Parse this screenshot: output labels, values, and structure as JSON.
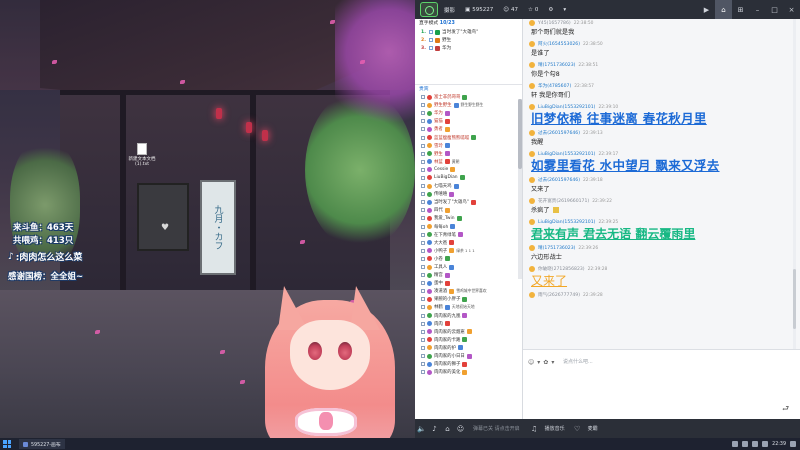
{
  "scene": {
    "desktop_file": {
      "name": "新建文本文档",
      "ext": "(1).txt"
    },
    "sign_text": "九月・カフ",
    "stats": {
      "line1": "来斗鱼：463天",
      "line2": "共喂鸡：413只"
    },
    "tiktok_text": ":肉肉怎么这么菜",
    "thanks_text": "感谢国榜：全全姐~"
  },
  "topbar": {
    "app_label": "摄影",
    "room_id": "595227",
    "viewers": "47",
    "likes": "0"
  },
  "left_col": {
    "header_label": "直手模式",
    "header_date": "10/23",
    "ranks": [
      {
        "num": "1.",
        "name": "当时发了\"大雄鸟\""
      },
      {
        "num": "2.",
        "name": "野生"
      },
      {
        "num": "3.",
        "name": "华为"
      }
    ],
    "members_title": "贵宾",
    "members": [
      {
        "name": "富士非鸽哥哥",
        "tag": "",
        "red": true
      },
      {
        "name": "野生野生",
        "tag": "野生野生野生",
        "red": true
      },
      {
        "name": "华为",
        "tag": "",
        "red": true
      },
      {
        "name": "猫猫",
        "tag": "",
        "red": true
      },
      {
        "name": "勇者",
        "tag": "",
        "red": true
      },
      {
        "name": "蓝蓝瘦瘦熊熊呱呱",
        "tag": "",
        "red": true
      },
      {
        "name": "雪玲",
        "tag": "",
        "red": true
      },
      {
        "name": "野生",
        "tag": "",
        "red": true
      },
      {
        "name": "林蓝",
        "tag": "黄朝",
        "red": true
      },
      {
        "name": "Cessie",
        "tag": "",
        "red": false
      },
      {
        "name": "LiuBigDian",
        "tag": "",
        "red": false
      },
      {
        "name": "七喵天鸡",
        "tag": "",
        "red": false
      },
      {
        "name": "传嘻嘻",
        "tag": "",
        "red": false
      },
      {
        "name": "当时发了\"大雄鸟\"",
        "tag": "",
        "red": false
      },
      {
        "name": "四代",
        "tag": "",
        "red": false
      },
      {
        "name": "我爱_Twin",
        "tag": "",
        "red": false
      },
      {
        "name": "每每oh",
        "tag": "",
        "red": false
      },
      {
        "name": "在下青绿笔",
        "tag": "",
        "red": false
      },
      {
        "name": "大大爸",
        "tag": "",
        "red": false
      },
      {
        "name": "小鸭子",
        "tag": "绿茶 1 1 1",
        "red": false
      },
      {
        "name": "小卷",
        "tag": "",
        "red": false
      },
      {
        "name": "工具人",
        "tag": "",
        "red": false
      },
      {
        "name": "精宫",
        "tag": "",
        "red": false
      },
      {
        "name": "蛋中",
        "tag": "",
        "red": false
      },
      {
        "name": "凑道酒",
        "tag": "雪鸡城中世界喜欢",
        "red": false
      },
      {
        "name": "果腕的小胖子",
        "tag": "",
        "red": false
      },
      {
        "name": "林鹤",
        "tag": "天地初始天地",
        "red": false
      },
      {
        "name": "肉肉家的九凰",
        "tag": "",
        "red": false
      },
      {
        "name": "肉肉",
        "tag": "",
        "red": false
      },
      {
        "name": "肉肉家的云烟崽",
        "tag": "",
        "red": false
      },
      {
        "name": "肉肉家的卡路",
        "tag": "",
        "red": false
      },
      {
        "name": "肉肉家的护",
        "tag": "",
        "red": false
      },
      {
        "name": "肉肉家的小日日",
        "tag": "",
        "red": false
      },
      {
        "name": "肉肉家的狮子",
        "tag": "",
        "red": false
      },
      {
        "name": "肉肉家的美化",
        "tag": "",
        "red": false
      }
    ]
  },
  "chat": [
    {
      "name": "Y45(1657786)",
      "time": "22:38:50",
      "text": "那个哥们就是我",
      "style": "normal",
      "gray": true
    },
    {
      "name": "阿火(1654553026)",
      "time": "22:38:50",
      "text": "是谁了",
      "style": "normal",
      "gray": false
    },
    {
      "name": "晴(1751736023)",
      "time": "22:38:51",
      "text": "你是个勾8",
      "style": "normal",
      "gray": false
    },
    {
      "name": "华为(4785607)",
      "time": "22:38:57",
      "text": "轩    我是你哥们",
      "style": "normal",
      "gray": false
    },
    {
      "name": "LiuBigDian(1553292101)",
      "time": "22:39:10",
      "text": "旧梦依稀 往事迷离 春花秋月里",
      "style": "big",
      "gray": false
    },
    {
      "name": "过去(2601597646)",
      "time": "22:39:13",
      "text": "我醒",
      "style": "normal",
      "gray": false
    },
    {
      "name": "LiuBigDian(1553292101)",
      "time": "22:39:17",
      "text": "如雾里看花 水中望月 飘来又浮去",
      "style": "big",
      "gray": false
    },
    {
      "name": "过去(2601597646)",
      "time": "22:39:18",
      "text": "又来了",
      "style": "normal",
      "gray": false
    },
    {
      "name": "花开富贵(2619660171)",
      "time": "22:39:22",
      "text": "杀疯了",
      "style": "pen",
      "gray": true
    },
    {
      "name": "LiuBigDian(1553292101)",
      "time": "22:39:25",
      "text": "君来有声 君去无语 翻云覆雨里",
      "style": "green",
      "gray": false
    },
    {
      "name": "晴(1751736023)",
      "time": "22:39:26",
      "text": "六边形战士",
      "style": "normal",
      "gray": false
    },
    {
      "name": "你破晓(2712856823)",
      "time": "22:39:28",
      "text": "又来了",
      "style": "orange",
      "gray": true
    },
    {
      "name": "雨气(2626777749)",
      "time": "22:39:28",
      "text": "",
      "style": "normal",
      "gray": true
    }
  ],
  "input": {
    "placeholder": "说点什么吧..."
  },
  "bottombar": {
    "mute_label": "弹幕已关 请点击开启",
    "music_label": "播放音乐",
    "other_label": "麦霸"
  },
  "taskbar": {
    "app_label": "595227-画布",
    "clock": "22:39"
  }
}
